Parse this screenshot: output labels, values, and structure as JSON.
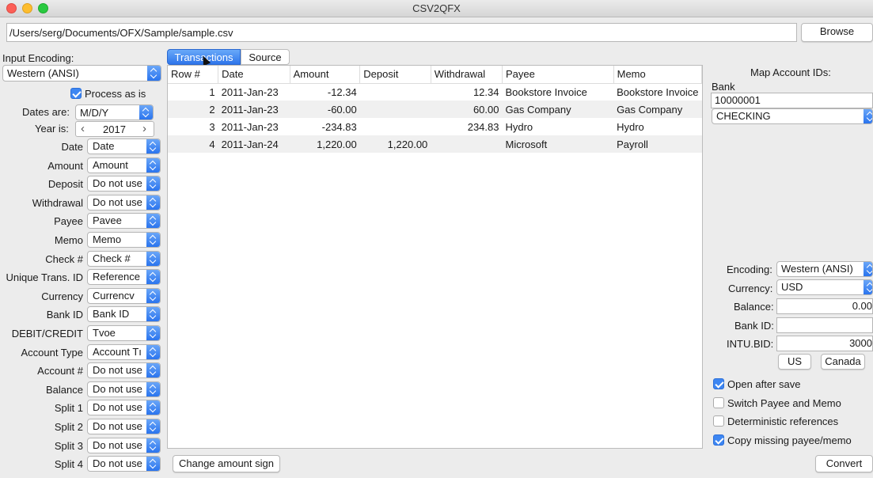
{
  "window": {
    "title": "CSV2QFX"
  },
  "file": {
    "path": "/Users/serg/Documents/OFX/Sample/sample.csv",
    "browse_label": "Browse"
  },
  "left": {
    "encoding_label": "Input Encoding:",
    "encoding_value": "Western (ANSI)",
    "process_label": "Process as is",
    "process_checked": true,
    "dates_label": "Dates are:",
    "dates_value": "M/D/Y",
    "year_label": "Year is:",
    "year_value": "2017",
    "year_prev": "‹",
    "year_next": "›",
    "mappings": [
      {
        "label": "Date",
        "value": "Date"
      },
      {
        "label": "Amount",
        "value": "Amount"
      },
      {
        "label": "Deposit",
        "value": "Do not use"
      },
      {
        "label": "Withdrawal",
        "value": "Do not use"
      },
      {
        "label": "Payee",
        "value": "Pavee"
      },
      {
        "label": "Memo",
        "value": "Memo"
      },
      {
        "label": "Check #",
        "value": "Check #"
      },
      {
        "label": "Unique Trans. ID",
        "value": "Reference"
      },
      {
        "label": "Currency",
        "value": "Currencv"
      },
      {
        "label": "Bank ID",
        "value": "Bank ID"
      },
      {
        "label": "DEBIT/CREDIT",
        "value": "Tvoe"
      },
      {
        "label": "Account Type",
        "value": "Account Tı"
      },
      {
        "label": "Account #",
        "value": "Do not use"
      },
      {
        "label": "Balance",
        "value": "Do not use"
      },
      {
        "label": "Split 1",
        "value": "Do not use"
      },
      {
        "label": "Split 2",
        "value": "Do not use"
      },
      {
        "label": "Split 3",
        "value": "Do not use"
      },
      {
        "label": "Split 4",
        "value": "Do not use"
      }
    ]
  },
  "tabs": [
    {
      "label": "Transactions",
      "active": true
    },
    {
      "label": "Source",
      "active": false
    }
  ],
  "table": {
    "columns": [
      "Row #",
      "Date",
      "Amount",
      "Deposit",
      "Withdrawal",
      "Payee",
      "Memo"
    ],
    "rows": [
      [
        "1",
        "2011-Jan-23",
        "-12.34",
        "",
        "12.34",
        "Bookstore Invoice",
        "Bookstore Invoice"
      ],
      [
        "2",
        "2011-Jan-23",
        "-60.00",
        "",
        "60.00",
        "Gas Company",
        "Gas Company"
      ],
      [
        "3",
        "2011-Jan-23",
        "-234.83",
        "",
        "234.83",
        "Hydro",
        "Hydro"
      ],
      [
        "4",
        "2011-Jan-24",
        "1,220.00",
        "1,220.00",
        "",
        "Microsoft",
        "Payroll"
      ]
    ]
  },
  "bottom": {
    "change_sign_label": "Change amount sign",
    "convert_label": "Convert"
  },
  "right": {
    "map_title": "Map Account IDs:",
    "bank_label": "Bank",
    "bank_value": "10000001",
    "account_type_value": "CHECKING",
    "encoding_label": "Encoding:",
    "encoding_value": "Western (ANSI)",
    "currency_label": "Currency:",
    "currency_value": "USD",
    "balance_label": "Balance:",
    "balance_value": "0.00",
    "bankid_label": "Bank ID:",
    "bankid_value": "",
    "intubid_label": "INTU.BID:",
    "intubid_value": "3000",
    "us_label": "US",
    "canada_label": "Canada",
    "options": [
      {
        "label": "Open after save",
        "checked": true
      },
      {
        "label": "Switch Payee and Memo",
        "checked": false
      },
      {
        "label": "Deterministic references",
        "checked": false
      },
      {
        "label": "Copy missing payee/memo",
        "checked": true
      }
    ]
  },
  "colors": {
    "accent": "#3d86f2",
    "tab_active": "#2e75ea"
  }
}
